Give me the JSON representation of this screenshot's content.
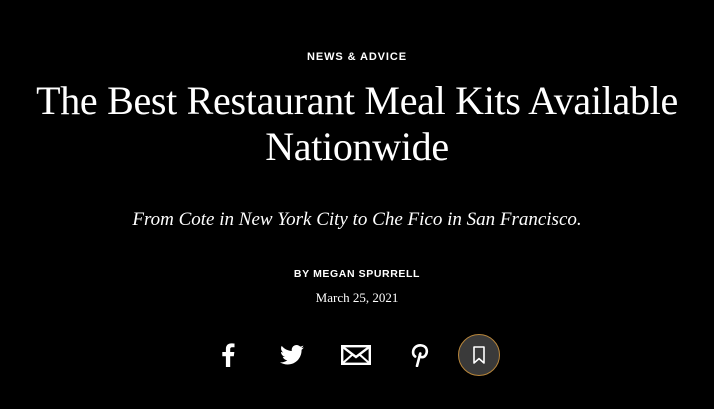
{
  "article": {
    "rubric": "NEWS & ADVICE",
    "headline_line1": "The Best Restaurant Meal Kits Available",
    "headline_line2": "Nationwide",
    "dek": "From Cote in New York City to Che Fico in San Francisco.",
    "byline_prefix": "BY",
    "author": "MEGAN SPURRELL",
    "date": "March 25, 2021"
  },
  "share": {
    "icons": [
      "facebook-icon",
      "twitter-icon",
      "email-icon",
      "pinterest-icon",
      "bookmark-icon"
    ]
  },
  "colors": {
    "background": "#000000",
    "text": "#ffffff",
    "save_button_fill": "#3a3a3a",
    "save_button_border": "#b8863b"
  }
}
